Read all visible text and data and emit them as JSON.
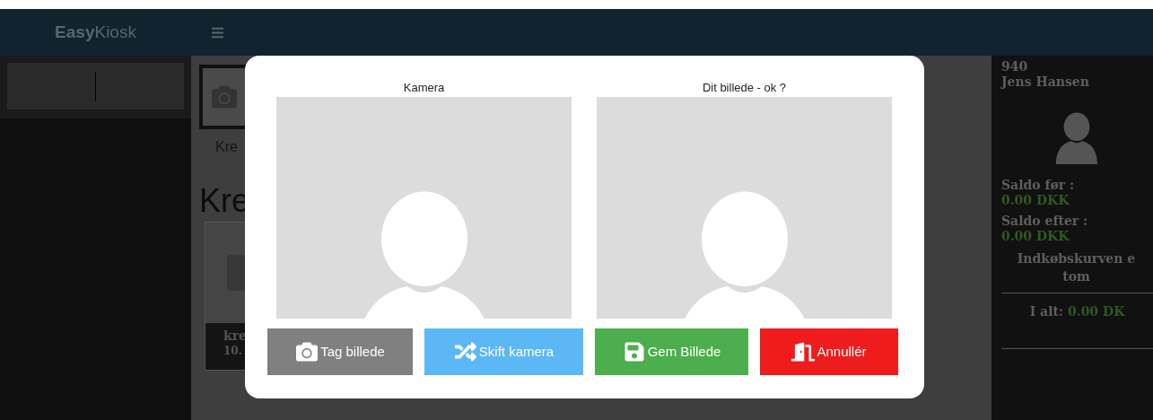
{
  "header": {
    "logo": {
      "bold": "Easy",
      "regular": "Kiosk"
    }
  },
  "main": {
    "category": {
      "label": "Kre"
    },
    "heading": "Kre",
    "product": {
      "name": "kre",
      "price": "10."
    }
  },
  "customer": {
    "number": "940",
    "name": "Jens Hansen",
    "balances": [
      {
        "label": "Saldo før :",
        "value": "0.00 DKK"
      },
      {
        "label": "Saldo efter :",
        "value": "0.00 DKK"
      }
    ],
    "cart_message": [
      "Indkøbskurven e",
      "tom"
    ],
    "total": {
      "label": "I alt:",
      "value": "0.00 DK"
    }
  },
  "modal": {
    "columns": [
      {
        "title": "Kamera"
      },
      {
        "title": "Dit billede - ok ?"
      }
    ],
    "buttons": [
      {
        "label": "Tag billede",
        "kind": "camera",
        "color": "#808080"
      },
      {
        "label": "Skift kamera",
        "kind": "switch",
        "color": "#5bb8f5"
      },
      {
        "label": "Gem Billede",
        "kind": "save",
        "color": "#4cae4c"
      },
      {
        "label": "Annullér",
        "kind": "cancel",
        "color": "#ee1c1c"
      }
    ]
  }
}
